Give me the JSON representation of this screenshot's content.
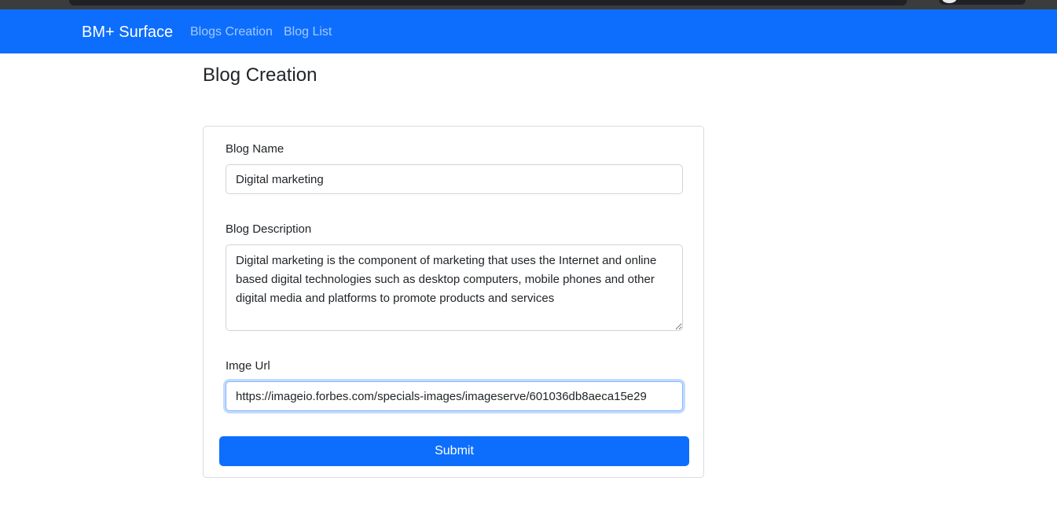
{
  "navbar": {
    "brand": "BM+ Surface",
    "links": [
      {
        "label": "Blogs Creation"
      },
      {
        "label": "Blog List"
      }
    ],
    "background": "#0d6efd"
  },
  "page": {
    "title": "Blog Creation"
  },
  "form": {
    "blog_name": {
      "label": "Blog Name",
      "value": "Digital marketing"
    },
    "blog_description": {
      "label": "Blog Description",
      "value": "Digital marketing is the component of marketing that uses the Internet and online based digital technologies such as desktop computers, mobile phones and other digital media and platforms to promote products and services"
    },
    "image_url": {
      "label": "Imge Url",
      "value": "https://imageio.forbes.com/specials-images/imageserve/601036db8aeca15e29"
    },
    "submit_label": "Submit"
  }
}
